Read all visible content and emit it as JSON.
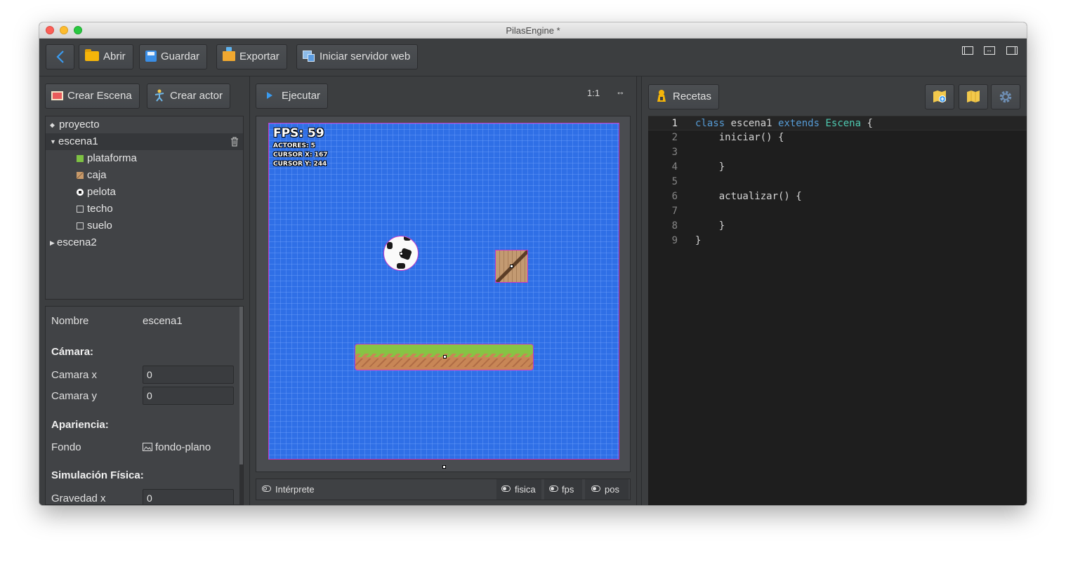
{
  "window": {
    "title": "PilasEngine *"
  },
  "toolbar": {
    "back_label": "<",
    "open_label": "Abrir",
    "save_label": "Guardar",
    "export_label": "Exportar",
    "server_label": "Iniciar servidor web",
    "layout_icons": [
      "layout-left-panel-icon",
      "layout-expand-icon",
      "layout-right-panel-icon"
    ]
  },
  "left": {
    "create_scene_label": "Crear Escena",
    "create_actor_label": "Crear actor",
    "tree": {
      "project": "proyecto",
      "scenes": [
        {
          "label": "escena1",
          "actors": [
            {
              "label": "plataforma",
              "color": "#7ec243"
            },
            {
              "label": "caja",
              "color": "#b7865a"
            },
            {
              "label": "pelota",
              "color": "#ffffff"
            },
            {
              "label": "techo",
              "color": "#3c3e40"
            },
            {
              "label": "suelo",
              "color": "#3c3e40"
            }
          ]
        },
        {
          "label": "escena2"
        }
      ]
    },
    "properties": {
      "name_label": "Nombre",
      "name_value": "escena1",
      "camera_heading": "Cámara:",
      "camera_x_label": "Camara x",
      "camera_x_value": "0",
      "camera_y_label": "Camara y",
      "camera_y_value": "0",
      "appearance_heading": "Apariencia:",
      "background_label": "Fondo",
      "background_value": "fondo-plano",
      "physics_heading": "Simulación Física:",
      "gravity_x_label": "Gravedad x",
      "gravity_x_value": "0"
    }
  },
  "middle": {
    "run_label": "Ejecutar",
    "zoom_label": "1:1",
    "expand_label": "↔",
    "overlay": {
      "fps": "FPS: 59",
      "actors": "ACTORES: 5",
      "cursor_x": "CURSOR X: 167",
      "cursor_y": "CURSOR Y: 244"
    },
    "bottom": {
      "interpreter_label": "Intérprete",
      "physics_label": "fisica",
      "fps_label": "fps",
      "pos_label": "pos"
    }
  },
  "right": {
    "recipes_label": "Recetas",
    "icon_buttons": [
      "map-add-icon",
      "map-icon",
      "gear-icon"
    ]
  },
  "editor": {
    "current_line": 1,
    "lines": [
      {
        "n": "1",
        "parts": [
          [
            "kw",
            "class"
          ],
          [
            "t",
            " escena1 "
          ],
          [
            "kw",
            "extends"
          ],
          [
            "t",
            " "
          ],
          [
            "ty",
            "Escena"
          ],
          [
            "t",
            " {"
          ]
        ]
      },
      {
        "n": "2",
        "parts": [
          [
            "t",
            "    iniciar() {"
          ]
        ]
      },
      {
        "n": "3",
        "parts": [
          [
            "t",
            ""
          ]
        ]
      },
      {
        "n": "4",
        "parts": [
          [
            "t",
            "    }"
          ]
        ]
      },
      {
        "n": "5",
        "parts": [
          [
            "t",
            ""
          ]
        ]
      },
      {
        "n": "6",
        "parts": [
          [
            "t",
            "    actualizar() {"
          ]
        ]
      },
      {
        "n": "7",
        "parts": [
          [
            "t",
            ""
          ]
        ]
      },
      {
        "n": "8",
        "parts": [
          [
            "t",
            "    }"
          ]
        ]
      },
      {
        "n": "9",
        "parts": [
          [
            "t",
            "}"
          ]
        ]
      }
    ]
  }
}
